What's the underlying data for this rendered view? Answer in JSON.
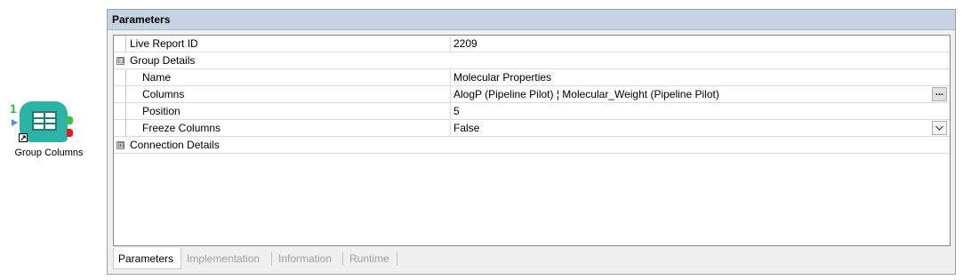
{
  "node": {
    "number": "1",
    "label": "Group Columns",
    "icon": "table-grid-icon"
  },
  "panel": {
    "title": "Parameters",
    "rows": [
      {
        "type": "prop",
        "name": "Live Report ID",
        "value": "2209"
      },
      {
        "type": "category",
        "name": "Group Details",
        "expander": "⊟"
      },
      {
        "type": "prop",
        "name": "Name",
        "value": "Molecular Properties"
      },
      {
        "type": "prop",
        "name": "Columns",
        "value": "AlogP (Pipeline Pilot) ¦ Molecular_Weight (Pipeline Pilot)",
        "button": "..."
      },
      {
        "type": "prop",
        "name": "Position",
        "value": "5"
      },
      {
        "type": "prop",
        "name": "Freeze Columns",
        "value": "False",
        "dropdown": true
      },
      {
        "type": "category",
        "name": "Connection Details",
        "expander": "⊞"
      }
    ]
  },
  "tabs": [
    {
      "label": "Parameters",
      "active": true
    },
    {
      "label": "Implementation",
      "active": false
    },
    {
      "label": "Information",
      "active": false
    },
    {
      "label": "Runtime",
      "active": false
    }
  ],
  "colors": {
    "header_bg": "#c5d3e3",
    "node_teal": "#2db3a5",
    "port_green": "#3fbf3f",
    "port_red": "#e02020",
    "port_blue": "#4a8fd8",
    "node_number": "#3cb93c"
  }
}
